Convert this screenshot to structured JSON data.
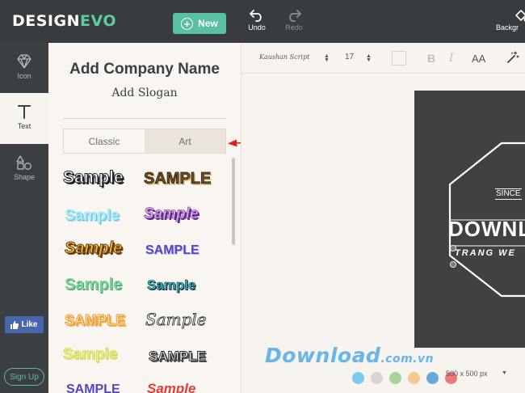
{
  "header": {
    "logo_design": "DESIGN",
    "logo_evo": "EVO",
    "new_label": "New",
    "undo_label": "Undo",
    "redo_label": "Redo",
    "background_label": "Backgr"
  },
  "nav": {
    "icon_label": "Icon",
    "text_label": "Text",
    "shape_label": "Shape",
    "like_label": "Like",
    "signup_label": "Sign Up"
  },
  "panel": {
    "company_name": "Add Company Name",
    "slogan": "Add Slogan",
    "tabs": [
      {
        "label": "Classic",
        "active": false
      },
      {
        "label": "Art",
        "active": true
      }
    ],
    "samples": [
      {
        "text": "Sample"
      },
      {
        "text": "SAMPLE"
      },
      {
        "text": "Sample"
      },
      {
        "text": "Sample"
      },
      {
        "text": "Sample"
      },
      {
        "text": "SAMPLE"
      },
      {
        "text": "Sample"
      },
      {
        "text": "Sample"
      },
      {
        "text": "SAMPLE"
      },
      {
        "text": "Sample"
      },
      {
        "text": "Sample"
      },
      {
        "text": "SAMPLE"
      },
      {
        "text": "SAMPLE"
      },
      {
        "text": "Sample"
      }
    ]
  },
  "format_bar": {
    "font_name": "Kaushan Script",
    "font_size": "17",
    "bold_label": "B",
    "italic_label": "I",
    "case_label": "AA"
  },
  "canvas": {
    "since_text": "SINCE",
    "brand_text": "DOWNL",
    "tagline_text": "TRANG WE",
    "size_label": "500 x 500 px",
    "swatches": [
      "#7cc8ee",
      "#d8d5d1",
      "#a9d39a",
      "#f7c88d",
      "#6aa8d8",
      "#ee7a7a"
    ]
  },
  "watermark": {
    "main": "Download",
    "suffix": ".com.vn"
  },
  "colors": {
    "accent": "#5bc0a3",
    "topbar": "#393c3f",
    "arrow": "#e02020"
  }
}
